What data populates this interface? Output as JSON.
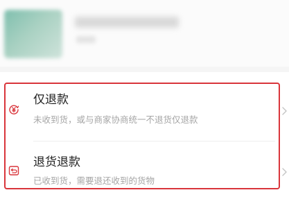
{
  "options": [
    {
      "title": "仅退款",
      "subtitle": "未收到货，或与商家协商统一不退货仅退款",
      "icon": "refund-yuan-icon"
    },
    {
      "title": "退货退款",
      "subtitle": "已收到货，需要退还收到的货物",
      "icon": "return-box-icon"
    }
  ],
  "colors": {
    "accent": "#d9343a",
    "title_text": "#1f1f1f",
    "subtitle_text": "#a6a6a6",
    "highlight_border": "#d9343a"
  }
}
